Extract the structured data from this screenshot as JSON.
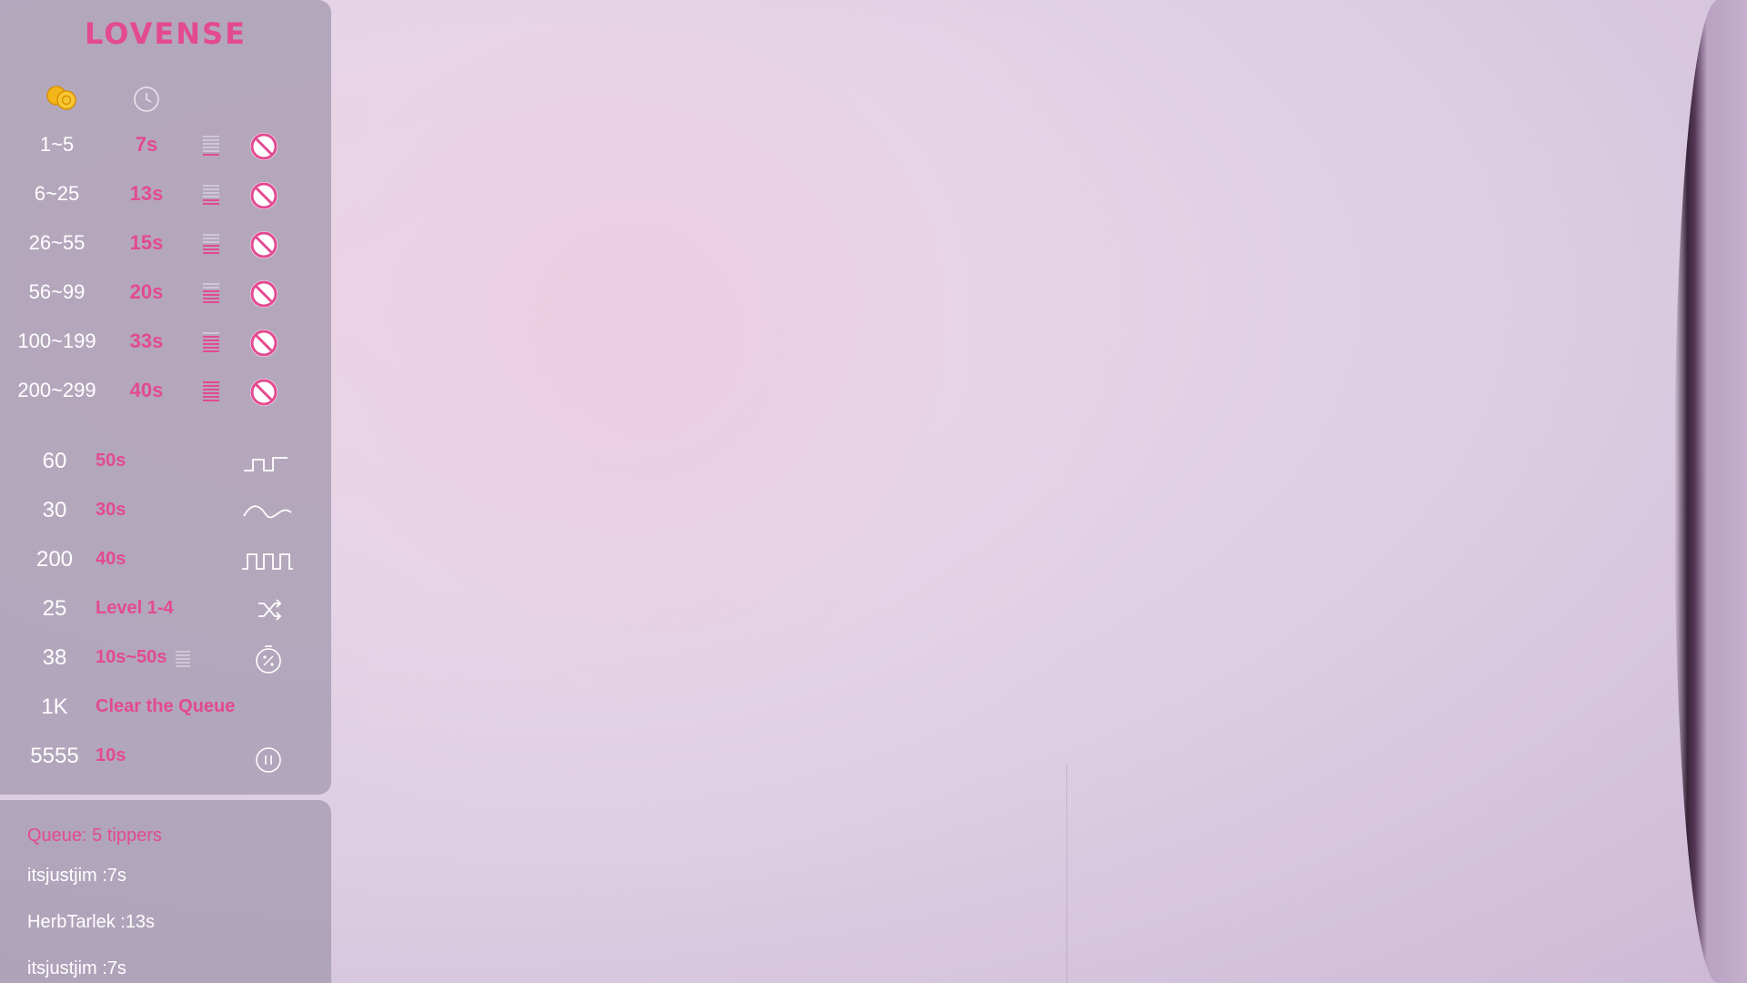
{
  "brand": {
    "logo_text": "LOVENSE",
    "accent": "#e34a91"
  },
  "levels_header": {
    "coins_icon": "coins-icon",
    "time_icon": "clock-icon"
  },
  "levels": [
    {
      "range": "1~5",
      "time": "7s",
      "level_bars": 1
    },
    {
      "range": "6~25",
      "time": "13s",
      "level_bars": 2
    },
    {
      "range": "26~55",
      "time": "15s",
      "level_bars": 3
    },
    {
      "range": "56~99",
      "time": "20s",
      "level_bars": 4
    },
    {
      "range": "100~199",
      "time": "33s",
      "level_bars": 5
    },
    {
      "range": "200~299",
      "time": "40s",
      "level_bars": 6
    }
  ],
  "specials": [
    {
      "amount": "60",
      "label": "50s",
      "icon": "step-wave-icon"
    },
    {
      "amount": "30",
      "label": "30s",
      "icon": "sine-wave-icon"
    },
    {
      "amount": "200",
      "label": "40s",
      "icon": "square-wave-icon"
    },
    {
      "amount": "25",
      "label": "Level 1-4",
      "icon": "shuffle-icon"
    },
    {
      "amount": "38",
      "label": "10s~50s",
      "icon": "random-time-icon"
    },
    {
      "amount": "1K",
      "label": "Clear the Queue",
      "icon": ""
    },
    {
      "amount": "5555",
      "label": "10s",
      "icon": "pause-icon"
    }
  ],
  "queue": {
    "title": "Queue: 5 tippers",
    "items": [
      "itsjustjim :7s",
      "HerbTarlek :13s",
      "itsjustjim :7s"
    ]
  }
}
